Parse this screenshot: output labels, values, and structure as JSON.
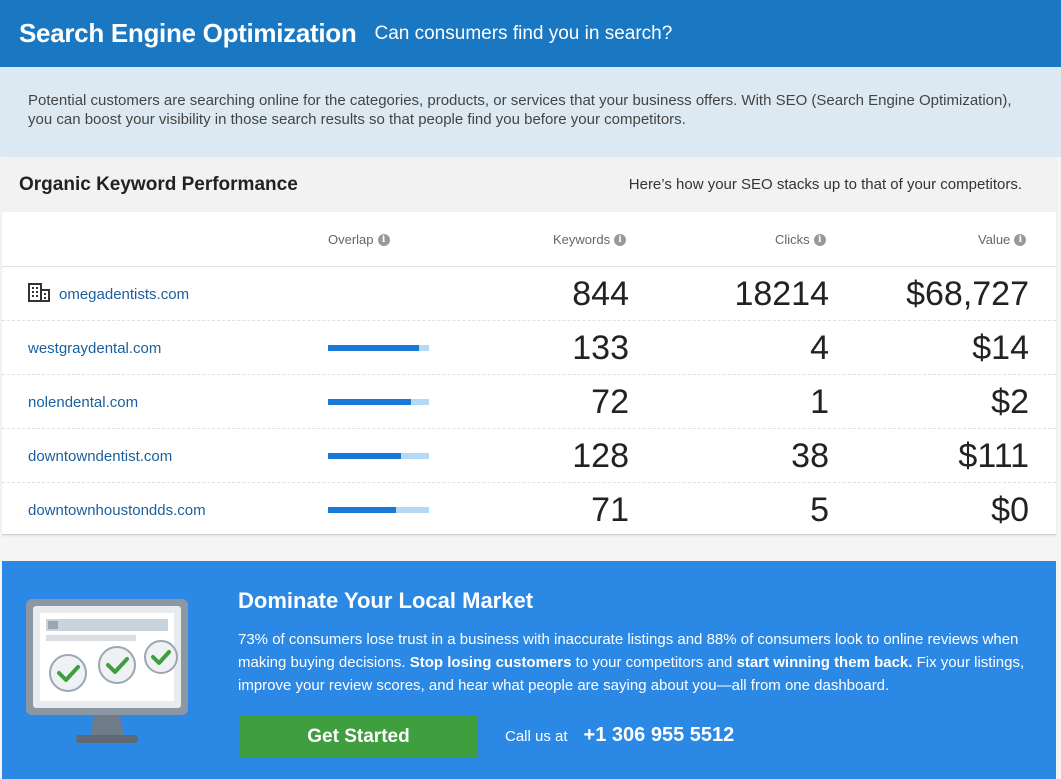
{
  "header": {
    "title": "Search Engine Optimization",
    "subtitle": "Can consumers find you in search?"
  },
  "intro": "Potential customers are searching online for the categories, products, or services that your business offers. With SEO (Search Engine Optimization), you can boost your visibility in those search results so that people find you before your competitors.",
  "section": {
    "title": "Organic Keyword Performance",
    "note": "Here’s how your SEO stacks up to that of your competitors."
  },
  "columns": {
    "overlap": "Overlap",
    "keywords": "Keywords",
    "clicks": "Clicks",
    "value": "Value"
  },
  "rows": [
    {
      "domain": "omegadentists.com",
      "overlap": null,
      "keywords": "844",
      "clicks": "18214",
      "value": "$68,727"
    },
    {
      "domain": "westgraydental.com",
      "overlap": 0.9,
      "keywords": "133",
      "clicks": "4",
      "value": "$14"
    },
    {
      "domain": "nolendental.com",
      "overlap": 0.82,
      "keywords": "72",
      "clicks": "1",
      "value": "$2"
    },
    {
      "domain": "downtowndentist.com",
      "overlap": 0.72,
      "keywords": "128",
      "clicks": "38",
      "value": "$111"
    },
    {
      "domain": "downtownhoustondds.com",
      "overlap": 0.67,
      "keywords": "71",
      "clicks": "5",
      "value": "$0"
    }
  ],
  "promo": {
    "title": "Dominate Your Local Market",
    "text_1": "73% of consumers lose trust in a business with inaccurate listings and 88% of consumers look to online reviews when making buying decisions.",
    "bold_1": "Stop losing customers",
    "text_2": "to your competitors and",
    "bold_2": "start winning them back.",
    "text_3": "Fix your listings, improve your review scores, and hear what people are saying about you—all from one dashboard.",
    "cta_label": "Get Started",
    "call_label": "Call us at",
    "phone": "+1 306 955 5512"
  },
  "icons": {
    "info": "info-icon",
    "own_business": "building-icon",
    "illustration": "monitor-checkmarks-icon"
  },
  "colors": {
    "header_bg": "#1a78c2",
    "link": "#1a5f9e",
    "promo_bg": "#2b88e5",
    "cta_bg": "#3f9e3d",
    "bar_fill": "#1a78d6",
    "bar_track": "#b5d8f5"
  }
}
